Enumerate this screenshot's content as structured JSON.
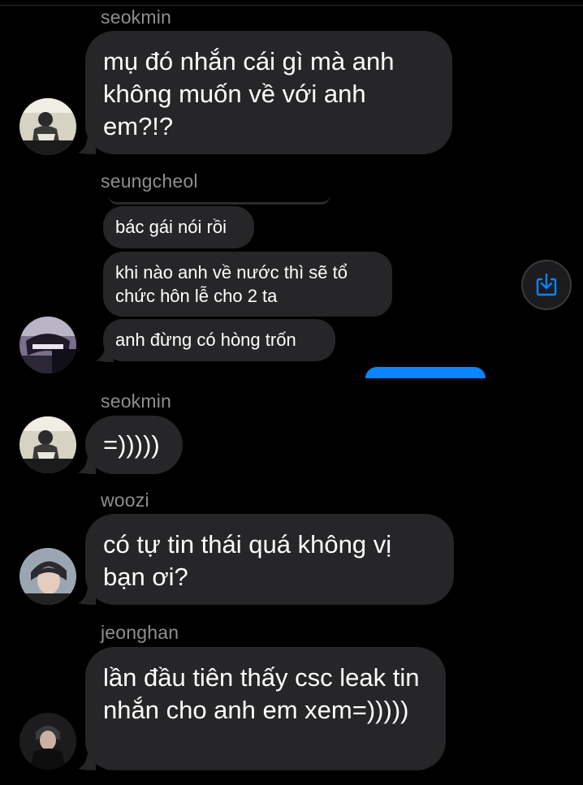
{
  "messages": [
    {
      "sender": "seokmin",
      "text": "mụ đó nhắn cái gì mà anh không muốn về với anh em?!?"
    },
    {
      "sender": "seungcheol",
      "texts": [
        "bác gái nói rồi",
        "khi nào anh về nước thì sẽ tổ chức hôn lễ cho 2 ta",
        "anh đừng có hòng trốn"
      ]
    },
    {
      "sender": "seokmin",
      "text": "=)))))"
    },
    {
      "sender": "woozi",
      "text": "có tự tin thái quá không vị bạn ơi?"
    },
    {
      "sender": "jeonghan",
      "text": "lần đầu tiên thấy csc leak tin nhắn cho anh em xem=)))))"
    }
  ],
  "icons": {
    "save": "save-to-device-icon"
  },
  "colors": {
    "background": "#000000",
    "bubble": "#262628",
    "sender_name": "#8e8e93",
    "accent": "#0a84ff"
  }
}
